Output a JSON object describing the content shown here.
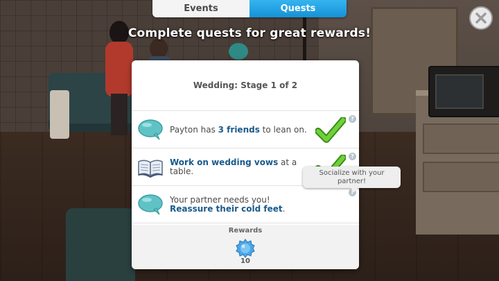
{
  "tabs": [
    {
      "label": "Events",
      "active": false
    },
    {
      "label": "Quests",
      "active": true
    }
  ],
  "heading": "Complete quests for great rewards!",
  "panel": {
    "stage_title": "Wedding: Stage 1 of 2",
    "tasks": [
      {
        "icon": "speech-bubble-icon",
        "text_pre": "Payton has ",
        "text_highlight": "3 friends",
        "text_post": " to lean on.",
        "completed": true
      },
      {
        "icon": "book-icon",
        "text_highlight": "Work on wedding vows",
        "text_post": " at a table.",
        "completed": true
      },
      {
        "icon": "speech-bubble-icon",
        "text_pre": "Your partner needs you!",
        "text_highlight": "Reassure their cold feet",
        "text_post": ".",
        "completed": false
      }
    ],
    "info_glyph": "?",
    "rewards": {
      "label": "Rewards",
      "icon": "blue-gem-badge-icon",
      "value": "10"
    }
  },
  "tooltip": {
    "text": "Socialize with your partner!"
  },
  "close": {
    "icon": "close-x-icon"
  },
  "colors": {
    "quests_tab": "#1a9fe0",
    "highlight_text": "#1a5a8a",
    "check_green": "#5bbf2a",
    "speech_bubble": "#5fc3c6"
  }
}
